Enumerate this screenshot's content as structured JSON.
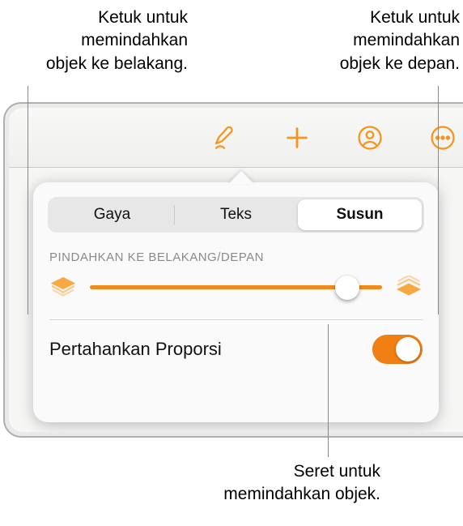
{
  "callouts": {
    "topLeft": "Ketuk untuk\nmemindahkan\nobjek ke belakang.",
    "topRight": "Ketuk untuk\nmemindahkan\nobjek ke depan.",
    "bottom": "Seret untuk\nmemindahkan objek."
  },
  "tabs": {
    "gaya": "Gaya",
    "teks": "Teks",
    "susun": "Susun",
    "selected": "susun"
  },
  "section": {
    "header": "Pindahkan ke Belakang/Depan"
  },
  "slider": {
    "valuePercent": 88
  },
  "row": {
    "keepProportions": "Pertahankan Proporsi",
    "toggleOn": true
  },
  "icons": {
    "backStack": "layers-back-icon",
    "frontStack": "layers-front-icon",
    "brush": "brush-icon",
    "add": "plus-icon",
    "collab": "person-plus-icon",
    "more": "ellipsis-icon"
  },
  "colors": {
    "accent": "#f08014"
  }
}
